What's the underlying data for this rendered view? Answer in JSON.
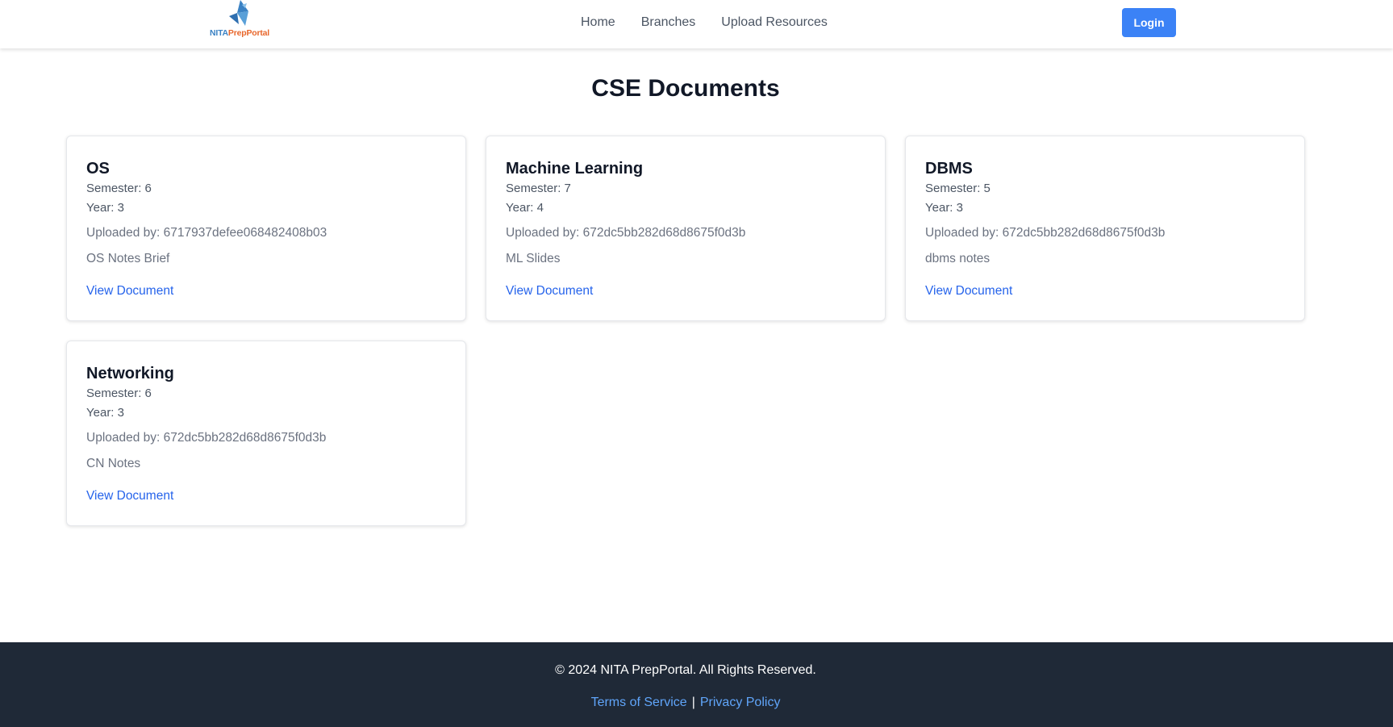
{
  "header": {
    "logo_text_part1": "NITA",
    "logo_text_part2": "PrepPortal",
    "nav": [
      {
        "label": "Home"
      },
      {
        "label": "Branches"
      },
      {
        "label": "Upload Resources"
      }
    ],
    "login_label": "Login"
  },
  "main": {
    "title": "CSE Documents",
    "documents": [
      {
        "title": "OS",
        "semester": "Semester: 6",
        "year": "Year: 3",
        "uploaded_by": "Uploaded by: 6717937defee068482408b03",
        "description": "OS Notes Brief",
        "link_label": "View Document"
      },
      {
        "title": "Machine Learning",
        "semester": "Semester: 7",
        "year": "Year: 4",
        "uploaded_by": "Uploaded by: 672dc5bb282d68d8675f0d3b",
        "description": "ML Slides",
        "link_label": "View Document"
      },
      {
        "title": "DBMS",
        "semester": "Semester: 5",
        "year": "Year: 3",
        "uploaded_by": "Uploaded by: 672dc5bb282d68d8675f0d3b",
        "description": "dbms notes",
        "link_label": "View Document"
      },
      {
        "title": "Networking",
        "semester": "Semester: 6",
        "year": "Year: 3",
        "uploaded_by": "Uploaded by: 672dc5bb282d68d8675f0d3b",
        "description": "CN Notes",
        "link_label": "View Document"
      }
    ]
  },
  "footer": {
    "copyright": "© 2024 NITA PrepPortal. All Rights Reserved.",
    "terms_label": "Terms of Service",
    "separator": "|",
    "privacy_label": "Privacy Policy"
  },
  "colors": {
    "accent": "#3b82f6",
    "link": "#2563eb",
    "footer_bg": "#1f2937",
    "logo_blue": "#3b82c4",
    "logo_orange": "#e8672c"
  },
  "icons": {
    "logo": "nita-prepportal-logo-icon"
  }
}
